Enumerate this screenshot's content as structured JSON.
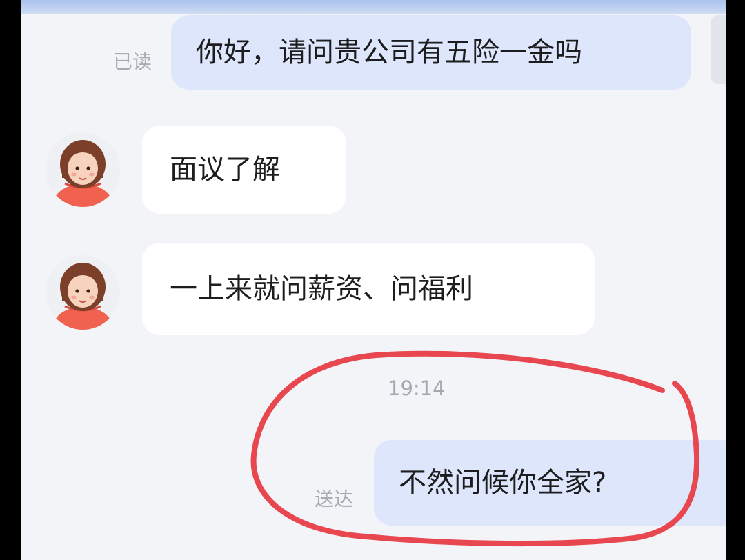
{
  "conversation": {
    "messages": [
      {
        "direction": "outgoing",
        "text": "你好，请问贵公司有五险一金吗",
        "status": "已读"
      },
      {
        "direction": "incoming",
        "text": "面议了解"
      },
      {
        "direction": "incoming",
        "text": "一上来就问薪资、问福利"
      },
      {
        "direction": "outgoing",
        "text": "不然问候你全家?",
        "status": "送达"
      }
    ],
    "timestamp": "19:14"
  },
  "colors": {
    "background": "#f3f4f8",
    "outgoing_bubble": "#dde6fb",
    "incoming_bubble": "#ffffff",
    "highlight_circle": "#e8474f",
    "avatar_shirt": "#f0624f",
    "avatar_hair": "#7b3f2a"
  },
  "icons": {
    "avatar": "cartoon-girl-avatar-icon"
  }
}
